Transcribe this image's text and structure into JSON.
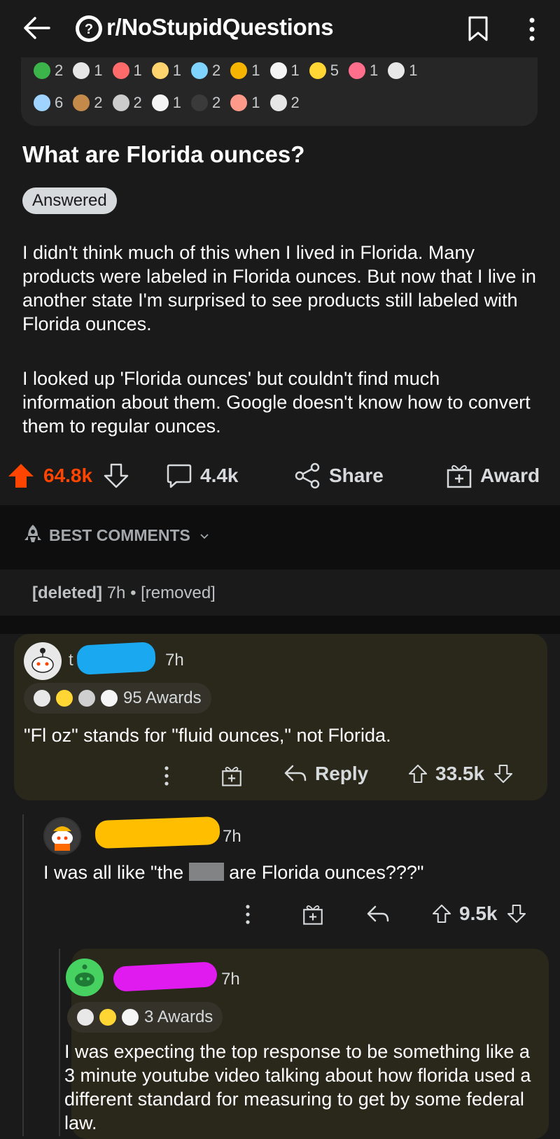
{
  "header": {
    "subreddit": "r/NoStupidQuestions"
  },
  "awards": {
    "row1": [
      {
        "icon": "award-icon",
        "count": "2",
        "color": "#3bb54a"
      },
      {
        "icon": "award-icon",
        "count": "1",
        "color": "#e6e6e6"
      },
      {
        "icon": "award-icon",
        "count": "1",
        "color": "#ff6b6b"
      },
      {
        "icon": "award-icon",
        "count": "1",
        "color": "#ffd36e"
      },
      {
        "icon": "award-icon",
        "count": "2",
        "color": "#7fd3ff"
      },
      {
        "icon": "award-icon",
        "count": "1",
        "color": "#f4b400"
      },
      {
        "icon": "award-icon",
        "count": "1",
        "color": "#f5f5f5"
      },
      {
        "icon": "award-icon",
        "count": "5",
        "color": "#ffd633"
      },
      {
        "icon": "award-icon",
        "count": "1",
        "color": "#ff6f8c"
      },
      {
        "icon": "award-icon",
        "count": "1",
        "color": "#e8e8e8"
      }
    ],
    "row2": [
      {
        "icon": "award-icon",
        "count": "6",
        "color": "#9ed4ff"
      },
      {
        "icon": "award-icon",
        "count": "2",
        "color": "#c48a4a"
      },
      {
        "icon": "award-icon",
        "count": "2",
        "color": "#cccccc"
      },
      {
        "icon": "award-icon",
        "count": "1",
        "color": "#f5f5f5"
      },
      {
        "icon": "award-icon",
        "count": "2",
        "color": "#3a3a3b"
      },
      {
        "icon": "award-icon",
        "count": "1",
        "color": "#ff9a8a"
      },
      {
        "icon": "award-icon",
        "count": "2",
        "color": "#e6e6e6"
      }
    ]
  },
  "post": {
    "title": "What are Florida ounces?",
    "flair": "Answered",
    "paragraph1": "I didn't think much of this when I lived in Florida. Many products were labeled in Florida ounces. But now that I live in another state I'm surprised to see products still labeled with Florida ounces.",
    "paragraph2": "I looked up 'Florida ounces' but couldn't find much information about them. Google doesn't know how to convert them to regular ounces.",
    "upvotes": "64.8k",
    "comments": "4.4k",
    "share_label": "Share",
    "award_label": "Award"
  },
  "sort": {
    "label": "BEST COMMENTS"
  },
  "deleted_comment": {
    "author": "[deleted]",
    "time": "7h",
    "separator": "•",
    "status": "[removed]"
  },
  "comments": [
    {
      "author_initial": "t",
      "time": "7h",
      "awards_label": "95 Awards",
      "text": "\"Fl oz\" stands for \"fluid ounces,\" not Florida.",
      "reply_label": "Reply",
      "score": "33.5k"
    },
    {
      "time": "7h",
      "text_before": "I was all like \"the",
      "text_after": "are Florida ounces???\"",
      "score": "9.5k"
    },
    {
      "time": "7h",
      "awards_label": "3 Awards",
      "text": "I was expecting the top response to be something like a 3 minute youtube video talking about how florida used a different standard for measuring to get by some federal law."
    }
  ],
  "colors": {
    "upvote_active": "#ff4500",
    "background": "#1a1a1b",
    "highlight_comment": "#2a271b",
    "redact_blue": "#1aa8f0",
    "redact_orange": "#ffbf00",
    "redact_magenta": "#e01bf0"
  }
}
